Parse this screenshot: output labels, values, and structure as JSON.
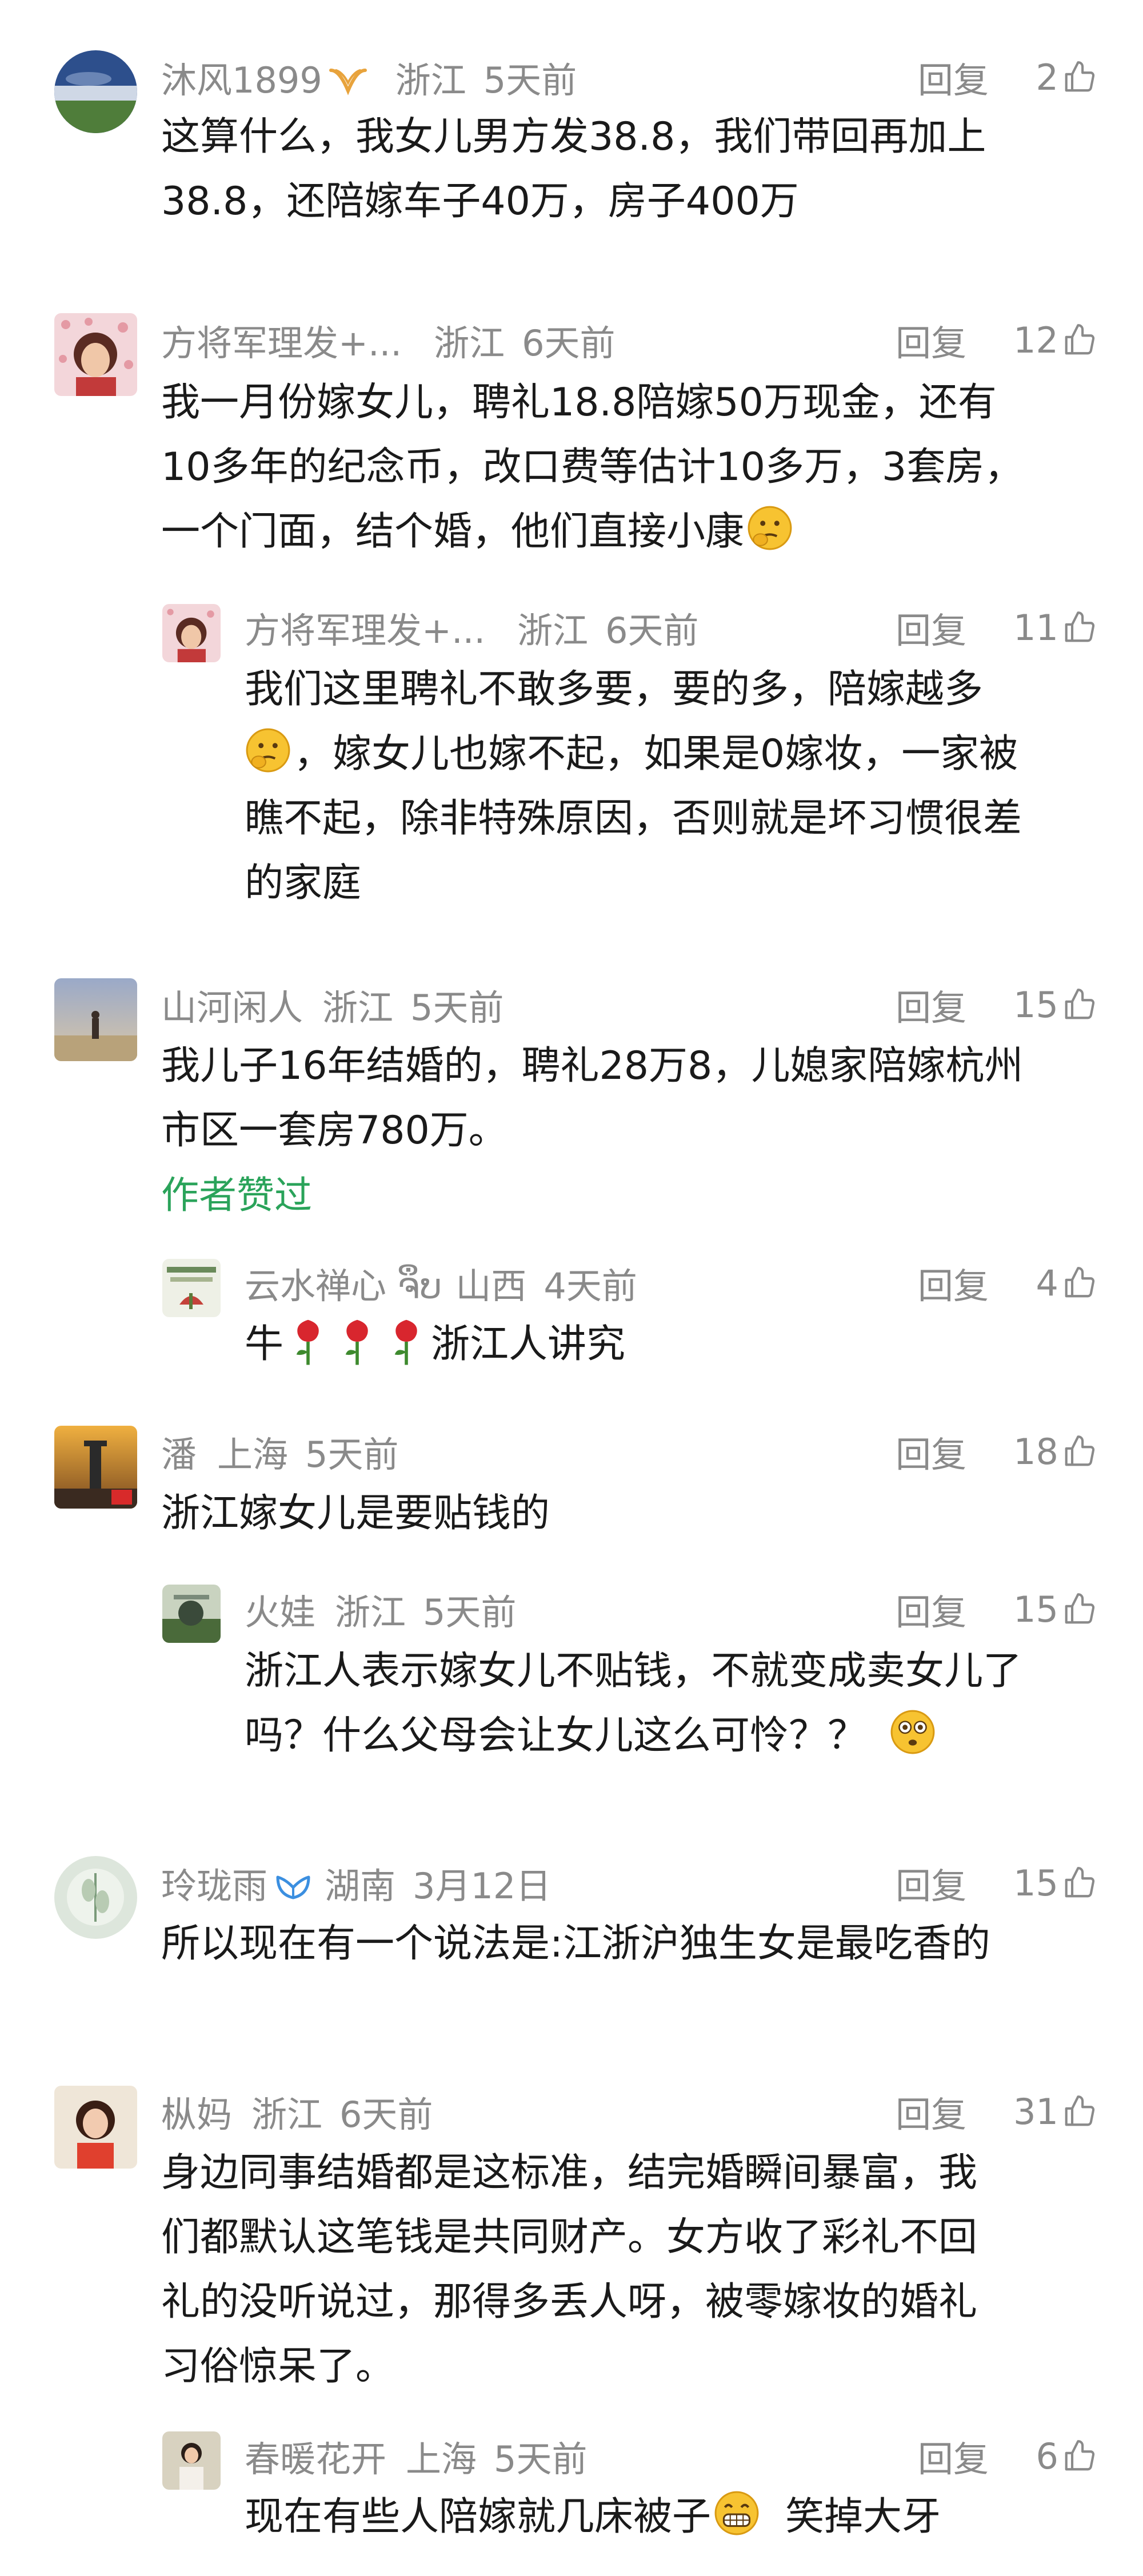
{
  "comments": [
    {
      "author": "沐风1899",
      "region": "浙江",
      "time": "5天前",
      "reply_label": "回复",
      "likes": "2",
      "lines": [
        "这算什么，我女儿男方发38.8，我们带回再加上",
        "38.8，还陪嫁车子40万，房子400万"
      ]
    },
    {
      "author": "方将军理发+...",
      "region": "浙江",
      "time": "6天前",
      "reply_label": "回复",
      "likes": "12",
      "lines": [
        "我一月份嫁女儿，聘礼18.8陪嫁50万现金，还有",
        "10多年的纪念币，改口费等估计10多万，3套房，",
        "一个门面，结个婚，他们直接小康"
      ]
    },
    {
      "author": "方将军理发+...",
      "region": "浙江",
      "time": "6天前",
      "reply_label": "回复",
      "likes": "11",
      "lines": [
        "我们这里聘礼不敢多要，要的多，陪嫁越多",
        "，嫁女儿也嫁不起，如果是0嫁妆，一家被",
        "瞧不起，除非特殊原因，否则就是坏习惯很差",
        "的家庭"
      ]
    },
    {
      "author": "山河闲人",
      "region": "浙江",
      "time": "5天前",
      "reply_label": "回复",
      "likes": "15",
      "lines": [
        "我儿子16年结婚的，聘礼28万8，儿媳家陪嫁杭州",
        "市区一套房780万。"
      ],
      "author_liked": "作者赞过"
    },
    {
      "author": "云水禅心 ຈຶບ",
      "region": "山西",
      "time": "4天前",
      "reply_label": "回复",
      "likes": "4",
      "lines": [
        "牛",
        "浙江人讲究"
      ]
    },
    {
      "author": "潘",
      "region": "上海",
      "time": "5天前",
      "reply_label": "回复",
      "likes": "18",
      "lines": [
        "浙江嫁女儿是要贴钱的"
      ]
    },
    {
      "author": "火娃",
      "region": "浙江",
      "time": "5天前",
      "reply_label": "回复",
      "likes": "15",
      "lines": [
        "浙江人表示嫁女儿不贴钱，不就变成卖女儿了",
        "吗？什么父母会让女儿这么可怜？？"
      ]
    },
    {
      "author": "玲珑雨",
      "region": "湖南",
      "time": "3月12日",
      "reply_label": "回复",
      "likes": "15",
      "lines": [
        "所以现在有一个说法是:江浙沪独生女是最吃香的"
      ]
    },
    {
      "author": "枞妈",
      "region": "浙江",
      "time": "6天前",
      "reply_label": "回复",
      "likes": "31",
      "lines": [
        "身边同事结婚都是这标准，结完婚瞬间暴富，我",
        "们都默认这笔钱是共同财产。女方收了彩礼不回",
        "礼的没听说过，那得多丢人呀，被零嫁妆的婚礼",
        "习俗惊呆了。"
      ]
    },
    {
      "author": "春暖花开",
      "region": "上海",
      "time": "5天前",
      "reply_label": "回复",
      "likes": "6",
      "lines": [
        "现在有些人陪嫁就几床被子",
        "笑掉大牙"
      ]
    }
  ],
  "icons": {
    "thumb": "thumbs-up-icon",
    "vip_gold": "vip-badge-gold-icon",
    "vip_blue": "vip-badge-blue-icon",
    "thinking": "thinking-face-emoji",
    "flushed": "flushed-face-emoji",
    "grin": "grinning-face-emoji",
    "rose": "rose-emoji"
  },
  "colors": {
    "meta_gray": "#8a8a8a",
    "text_black": "#1a1a1a",
    "author_liked_green": "#2aa35a",
    "vip_gold": "#e8a33c",
    "vip_blue": "#3b8fe0"
  }
}
